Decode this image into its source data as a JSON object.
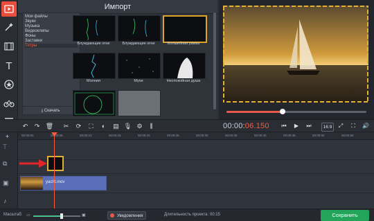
{
  "import_panel": {
    "title": "Импорт",
    "categories": [
      "Мои файлы",
      "Звуки",
      "Музыка",
      "Видеоклипы",
      "Фоны",
      "Заставки",
      "Титры"
    ],
    "selected_category": "Титры",
    "download_label": "Скачать",
    "thumbnails": [
      {
        "label": "Блуждающие огни"
      },
      {
        "label": "Блуждающие огни"
      },
      {
        "label": "Волшебная рамка"
      },
      {
        "label": "Молния"
      },
      {
        "label": "Мухи"
      },
      {
        "label": "Неспокойная душа"
      },
      {
        "label": ""
      },
      {
        "label": ""
      }
    ]
  },
  "preview": {
    "playback_progress": 0.4
  },
  "toolbar": {
    "timecode_prefix": "00:00:",
    "timecode_highlight": "06.150",
    "aspect_ratio": "16:9"
  },
  "timeline": {
    "ruler_ticks": [
      "00:00:00",
      "00:00:05",
      "00:00:10",
      "00:00:15",
      "00:00:20",
      "00:00:25",
      "00:00:30",
      "00:00:35",
      "00:00:40",
      "00:00:45",
      "00:00:50",
      "00:00:55"
    ],
    "video_clip_name": "yacht.mov"
  },
  "statusbar": {
    "scale_label": "Масштаб:",
    "scale_level": 0.6,
    "notifications_label": "Уведомления",
    "duration_label": "Длительность проекта:",
    "duration_value": "00:15",
    "save_label": "Сохранить"
  },
  "colors": {
    "accent": "#e94e3c",
    "timecode_highlight": "#ff5a3c",
    "save_button": "#22a55b",
    "clip_video": "#5a6fb8",
    "title_clip_border": "#e0b030",
    "progress": "#e9584a"
  }
}
